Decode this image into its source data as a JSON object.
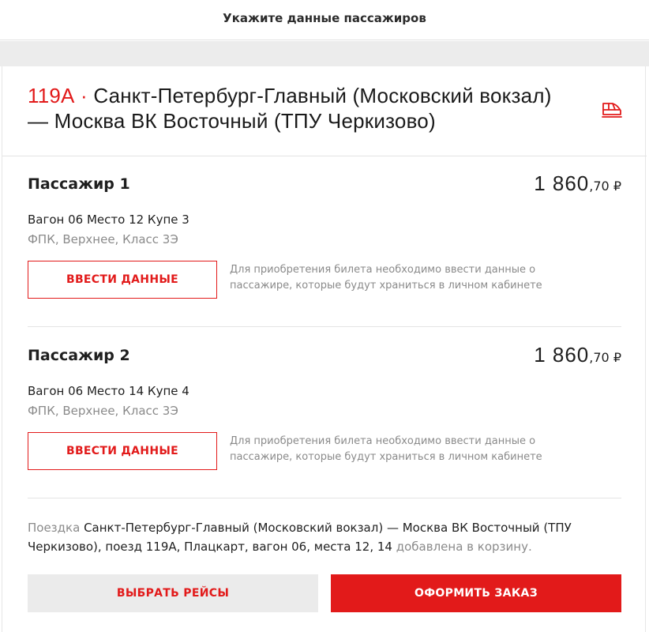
{
  "header": {
    "title": "Укажите данные пассажиров"
  },
  "route": {
    "train_number": "119А",
    "separator": " · ",
    "name": "Санкт-Петербург-Главный (Московский вокзал) — Москва ВК Восточный (ТПУ Черкизово)",
    "icon": "train-icon"
  },
  "passengers": [
    {
      "name": "Пассажир 1",
      "price_main": "1 860",
      "price_fraction": ",70",
      "currency": "₽",
      "place": "Вагон 06 Место 12 Купе 3",
      "class_info": "ФПК, Верхнее, Класс 3Э",
      "button_label": "ВВЕСТИ ДАННЫЕ",
      "hint": "Для приобретения билета необходимо ввести данные о пассажире, которые будут храниться в личном кабинете"
    },
    {
      "name": "Пассажир 2",
      "price_main": "1 860",
      "price_fraction": ",70",
      "currency": "₽",
      "place": "Вагон 06 Место 14 Купе 4",
      "class_info": "ФПК, Верхнее, Класс 3Э",
      "button_label": "ВВЕСТИ ДАННЫЕ",
      "hint": "Для приобретения билета необходимо ввести данные о пассажире, которые будут храниться в личном кабинете"
    }
  ],
  "cart_message": {
    "prefix": "Поездка",
    "details": "Санкт-Петербург-Главный (Московский вокзал) — Москва ВК Восточный (ТПУ Черкизово), поезд 119А, Плацкарт, вагон 06, места 12, 14",
    "suffix": "добавлена в корзину."
  },
  "actions": {
    "choose_trips": "ВЫБРАТЬ РЕЙСЫ",
    "checkout": "ОФОРМИТЬ ЗАКАЗ"
  },
  "colors": {
    "accent": "#e21a1a",
    "muted_text": "#8a8a8a",
    "background_gap": "#ececec"
  }
}
